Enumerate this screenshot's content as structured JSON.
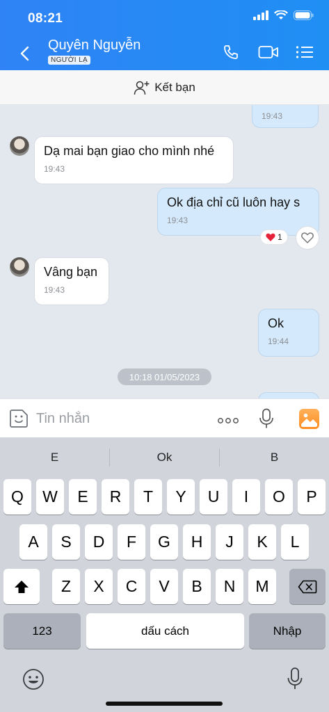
{
  "status_bar": {
    "time": "08:21"
  },
  "header": {
    "contact_name": "Quyên Nguyễn",
    "badge": "NGƯỜI LẠ"
  },
  "friend_bar": {
    "label": "Kết bạn"
  },
  "messages": [
    {
      "side": "out",
      "text": "",
      "time": "19:43"
    },
    {
      "side": "in",
      "text": "Dạ mai bạn giao cho mình nhé",
      "time": "19:43"
    },
    {
      "side": "out",
      "text": "Ok địa chỉ cũ luôn hay s",
      "time": "19:43",
      "reaction_count": "1"
    },
    {
      "side": "in",
      "text": "Vâng bạn",
      "time": "19:43"
    },
    {
      "side": "out",
      "text": "Ok",
      "time": "19:44"
    }
  ],
  "date_separator": "10:18 01/05/2023",
  "composer": {
    "placeholder": "Tin nhắn",
    "value": ""
  },
  "keyboard": {
    "suggestions": [
      "E",
      "Ok",
      "B"
    ],
    "row1": [
      "Q",
      "W",
      "E",
      "R",
      "T",
      "Y",
      "U",
      "I",
      "O",
      "P"
    ],
    "row2": [
      "A",
      "S",
      "D",
      "F",
      "G",
      "H",
      "J",
      "K",
      "L"
    ],
    "row3": [
      "Z",
      "X",
      "C",
      "V",
      "B",
      "N",
      "M"
    ],
    "numbers_key": "123",
    "space_key": "dấu cách",
    "return_key": "Nhập"
  },
  "colors": {
    "header_blue": "#2f83f5",
    "outgoing_bubble": "#d4e9fb",
    "incoming_bubble": "#ffffff",
    "heart_red": "#e5243b"
  }
}
